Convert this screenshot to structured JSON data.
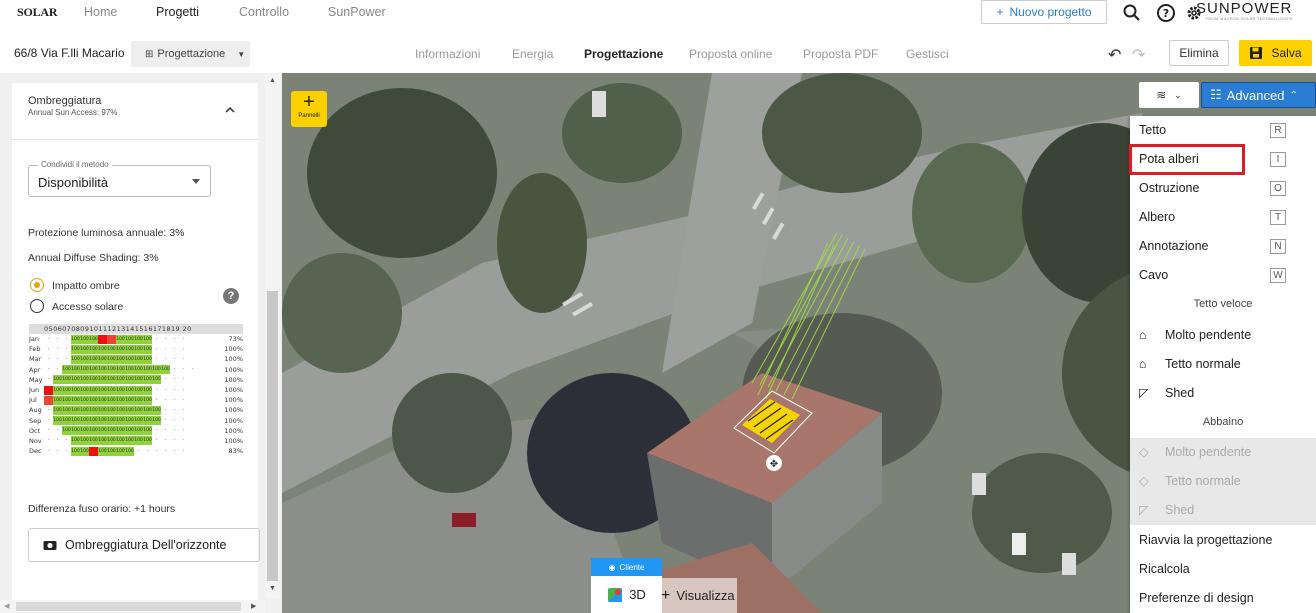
{
  "topnav": {
    "logo": "SOLAR",
    "items": [
      "Home",
      "Progetti",
      "Controllo",
      "SunPower"
    ],
    "active_index": 1,
    "new_project_label": "Nuovo progetto",
    "brand": "SUNPOWER",
    "brand_tagline": "FROM MAXEON SOLAR TECHNOLOGIES"
  },
  "subbar": {
    "address": "66/8 Via F.lli Macario",
    "mode_label": "Progettazione",
    "tabs": [
      "Informazioni",
      "Energia",
      "Progettazione",
      "Proposta online",
      "Proposta PDF",
      "Gestisci"
    ],
    "active_tab": 2,
    "delete_label": "Elimina",
    "save_label": "Salva"
  },
  "shading_panel": {
    "title": "Ombreggiatura",
    "subtitle": "Annual Sun Access: 97%",
    "method_legend": "Condividi il metodo",
    "method_value": "Disponibilità",
    "annual_light_protection": "Protezione luminosa annuale: 3%",
    "annual_diffuse_shading": "Annual Diffuse Shading: 3%",
    "radio_options": [
      "Impatto ombre",
      "Accesso solare"
    ],
    "radio_selected": 0,
    "hours_header": "050607080910111213141516171819 20",
    "months": [
      {
        "m": "Jan",
        "cells": "---gggrogggg----",
        "pct": "73%"
      },
      {
        "m": "Feb",
        "cells": "---ggggggggg----",
        "pct": "100%"
      },
      {
        "m": "Mar",
        "cells": "---ggggggggg----",
        "pct": "100%"
      },
      {
        "m": "Apr",
        "cells": "--gggggggggggg---",
        "pct": "100%"
      },
      {
        "m": "May",
        "cells": "-gggggggggggg---",
        "pct": "100%"
      },
      {
        "m": "Jun",
        "cells": "rggggggggggg----",
        "pct": "100%"
      },
      {
        "m": "Jul",
        "cells": "oggggggggggg----",
        "pct": "100%"
      },
      {
        "m": "Aug",
        "cells": "-gggggggggggg---",
        "pct": "100%"
      },
      {
        "m": "Sep",
        "cells": "-gggggggggggg---",
        "pct": "100%"
      },
      {
        "m": "Oct",
        "cells": "--gggggggggg----",
        "pct": "100%"
      },
      {
        "m": "Nov",
        "cells": "---ggggggggg----",
        "pct": "100%"
      },
      {
        "m": "Dec",
        "cells": "---ggrgggg------",
        "pct": "83%"
      }
    ],
    "timezone_diff": "Differenza fuso orario: +1 hours",
    "horizon_button": "Ombreggiatura Dell'orizzonte"
  },
  "map": {
    "add_panels_label": "Pannelli",
    "advanced_label": "Advanced",
    "client_badge": "Cliente",
    "view_3d_label": "3D",
    "visualize_label": "Visualizza"
  },
  "advanced_menu": {
    "items_top": [
      {
        "label": "Tetto",
        "key": "R"
      },
      {
        "label": "Pota alberi",
        "key": "I"
      },
      {
        "label": "Ostruzione",
        "key": "O"
      },
      {
        "label": "Albero",
        "key": "T"
      },
      {
        "label": "Annotazione",
        "key": "N"
      },
      {
        "label": "Cavo",
        "key": "W"
      }
    ],
    "section_fast_roof": "Tetto veloce",
    "fast_roof_items": [
      "Molto pendente",
      "Tetto normale",
      "Shed"
    ],
    "section_dormer": "Abbaino",
    "dormer_items": [
      "Molto pendente",
      "Tetto normale",
      "Shed"
    ],
    "bottom_items": [
      "Riavvia la progettazione",
      "Ricalcola",
      "Preferenze di design"
    ],
    "highlighted_item": "Pota alberi"
  },
  "colors": {
    "accent_yellow": "#fdd000",
    "primary_blue": "#2b7cd3",
    "highlight_red": "#e01b24",
    "shade_green": "#8fd33b"
  }
}
